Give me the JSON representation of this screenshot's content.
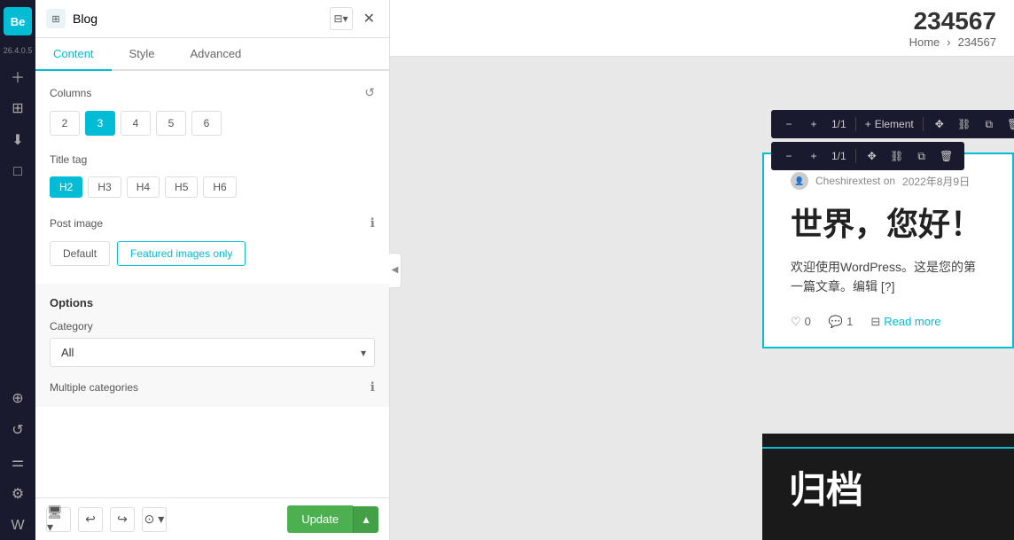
{
  "brand": {
    "logo": "Be",
    "version": "26.4.0.5"
  },
  "panel": {
    "title": "Blog",
    "tabs": [
      "Content",
      "Style",
      "Advanced"
    ],
    "active_tab": "Content"
  },
  "columns": {
    "label": "Columns",
    "options": [
      "2",
      "3",
      "4",
      "5",
      "6"
    ],
    "active": "3"
  },
  "title_tag": {
    "label": "Title tag",
    "options": [
      "H2",
      "H3",
      "H4",
      "H5",
      "H6"
    ],
    "active": "H2"
  },
  "post_image": {
    "label": "Post image",
    "options": [
      "Default",
      "Featured images only"
    ],
    "active": "Featured images only"
  },
  "options": {
    "title": "Options",
    "category": {
      "label": "Category",
      "value": "All"
    },
    "multiple_categories": {
      "label": "Multiple categories"
    }
  },
  "toolbar": {
    "update_label": "Update"
  },
  "element_toolbar": {
    "minus": "−",
    "plus": "+",
    "fraction": "1/1",
    "element_label": "Element"
  },
  "canvas": {
    "page_number": "234567",
    "breadcrumb_home": "Home",
    "breadcrumb_sep": "›",
    "breadcrumb_current": "234567"
  },
  "blog_post": {
    "author": "Cheshirextest on",
    "date": "2022年8月9日",
    "title": "世界，您好！",
    "excerpt": "欢迎使用WordPress。这是您的第一篇文章。编辑 [?]",
    "likes": "0",
    "comments": "1",
    "read_more": "Read more"
  },
  "archive": {
    "title": "归档"
  },
  "icons": {
    "plus": "+",
    "minus": "−",
    "close": "✕",
    "chevron_down": "▾",
    "heart": "♡",
    "comment": "💬",
    "bookmark": "⊟",
    "grid": "⊞",
    "move": "✥",
    "link": "⛓",
    "copy": "⧉",
    "trash": "🗑",
    "settings": "⚙",
    "undo": "↩",
    "redo": "↪",
    "screenshot": "⊙",
    "device": "🖥",
    "layers": "⊕",
    "refresh": "↺",
    "sliders": "⚌",
    "gear": "⚙",
    "wordpress": "W",
    "info": "ℹ"
  }
}
